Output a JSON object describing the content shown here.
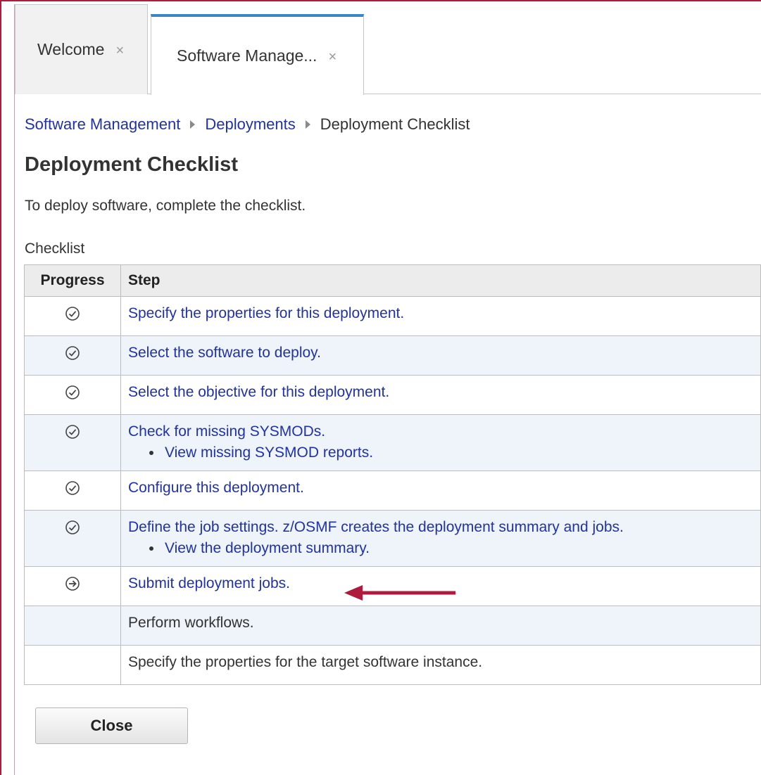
{
  "tabs": [
    {
      "label": "Welcome",
      "close": "×"
    },
    {
      "label": "Software Manage...",
      "close": "×"
    }
  ],
  "breadcrumb": {
    "items": [
      "Software Management",
      "Deployments"
    ],
    "current": "Deployment Checklist"
  },
  "page": {
    "title": "Deployment Checklist",
    "intro": "To deploy software, complete the checklist.",
    "caption": "Checklist"
  },
  "table": {
    "headers": {
      "progress": "Progress",
      "step": "Step"
    },
    "rows": [
      {
        "status": "check-circle-icon",
        "step": "Specify the properties for this deployment.",
        "link": true
      },
      {
        "status": "check-circle-icon",
        "step": "Select the software to deploy.",
        "link": true
      },
      {
        "status": "check-circle-icon",
        "step": "Select the objective for this deployment.",
        "link": true
      },
      {
        "status": "check-circle-icon",
        "step": "Check for missing SYSMODs.",
        "link": true,
        "sub": "View missing SYSMOD reports."
      },
      {
        "status": "check-circle-icon",
        "step": "Configure this deployment.",
        "link": true
      },
      {
        "status": "check-circle-icon",
        "step": "Define the job settings. z/OSMF creates the deployment summary and jobs.",
        "link": true,
        "sub": "View the deployment summary."
      },
      {
        "status": "arrow-circle-icon",
        "step": "Submit deployment jobs.",
        "link": true
      },
      {
        "status": "",
        "step": "Perform workflows.",
        "link": false
      },
      {
        "status": "",
        "step": "Specify the properties for the target software instance.",
        "link": false
      }
    ]
  },
  "buttons": {
    "close": "Close"
  },
  "colors": {
    "link": "#2032a8",
    "accent_tab": "#3b86c6",
    "annotation_arrow": "#b01a3c",
    "row_alt": "#eef4f9"
  }
}
